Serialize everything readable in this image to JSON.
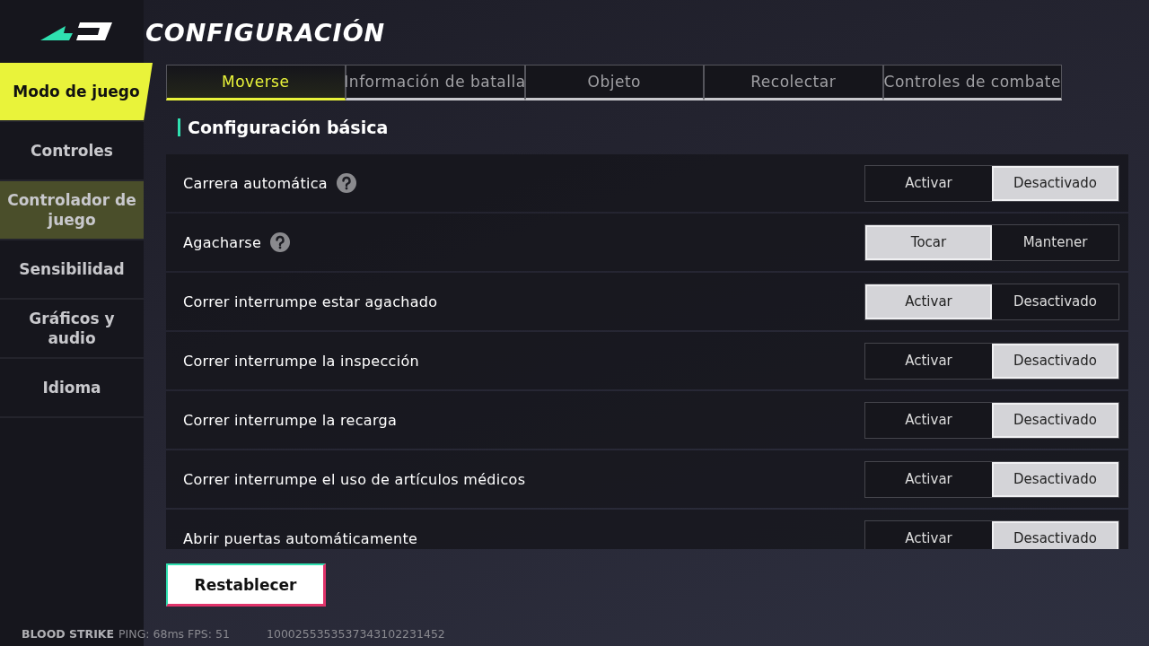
{
  "header": {
    "title": "CONFIGURACIÓN"
  },
  "sidebar": {
    "items": [
      {
        "label": "Modo de juego",
        "selected": true,
        "hovered": false
      },
      {
        "label": "Controles",
        "selected": false,
        "hovered": false
      },
      {
        "label": "Controlador de juego",
        "selected": false,
        "hovered": true
      },
      {
        "label": "Sensibilidad",
        "selected": false,
        "hovered": false
      },
      {
        "label": "Gráficos y audio",
        "selected": false,
        "hovered": false
      },
      {
        "label": "Idioma",
        "selected": false,
        "hovered": false
      }
    ]
  },
  "tabs": [
    {
      "label": "Moverse",
      "selected": true
    },
    {
      "label": "Información de batalla",
      "selected": false
    },
    {
      "label": "Objeto",
      "selected": false
    },
    {
      "label": "Recolectar",
      "selected": false
    },
    {
      "label": "Controles de combate",
      "selected": false
    }
  ],
  "section": {
    "title": "Configuración básica"
  },
  "settings": [
    {
      "label": "Carrera automática",
      "help": true,
      "options": [
        {
          "label": "Activar",
          "selected": false
        },
        {
          "label": "Desactivado",
          "selected": true
        }
      ]
    },
    {
      "label": "Agacharse",
      "help": true,
      "options": [
        {
          "label": "Tocar",
          "selected": true
        },
        {
          "label": "Mantener",
          "selected": false
        }
      ]
    },
    {
      "label": "Correr interrumpe estar agachado",
      "help": false,
      "options": [
        {
          "label": "Activar",
          "selected": true
        },
        {
          "label": "Desactivado",
          "selected": false
        }
      ]
    },
    {
      "label": "Correr interrumpe la inspección",
      "help": false,
      "options": [
        {
          "label": "Activar",
          "selected": false
        },
        {
          "label": "Desactivado",
          "selected": true
        }
      ]
    },
    {
      "label": "Correr interrumpe la recarga",
      "help": false,
      "options": [
        {
          "label": "Activar",
          "selected": false
        },
        {
          "label": "Desactivado",
          "selected": true
        }
      ]
    },
    {
      "label": "Correr interrumpe el uso de artículos médicos",
      "help": false,
      "options": [
        {
          "label": "Activar",
          "selected": false
        },
        {
          "label": "Desactivado",
          "selected": true
        }
      ]
    },
    {
      "label": "Abrir puertas automáticamente",
      "help": false,
      "options": [
        {
          "label": "Activar",
          "selected": false
        },
        {
          "label": "Desactivado",
          "selected": true
        }
      ]
    }
  ],
  "reset_button": "Restablecer",
  "status_bar": {
    "game": "BLOOD STRIKE",
    "stats": "PING: 68ms FPS: 51",
    "id": "1000255353537343102231452"
  }
}
